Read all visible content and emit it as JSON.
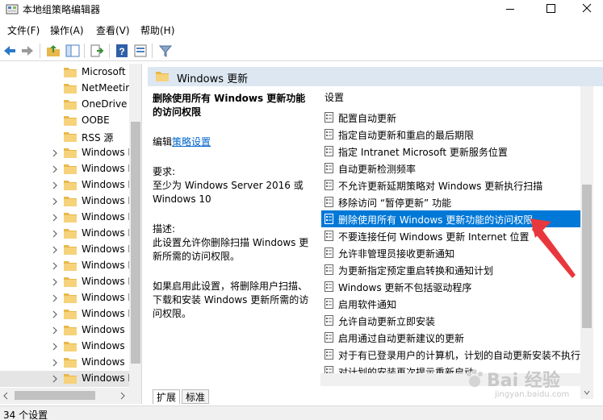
{
  "window": {
    "title": "本地组策略编辑器"
  },
  "menu": [
    "文件(F)",
    "操作(A)",
    "查看(V)",
    "帮助(H)"
  ],
  "tree": {
    "items": [
      {
        "label": "Microsoft",
        "expandable": false
      },
      {
        "label": "NetMeetir",
        "expandable": false
      },
      {
        "label": "OneDrive",
        "expandable": false
      },
      {
        "label": "OOBE",
        "expandable": false
      },
      {
        "label": "RSS 源",
        "expandable": false
      },
      {
        "label": "Windows I",
        "expandable": true
      },
      {
        "label": "Windows I",
        "expandable": true
      },
      {
        "label": "Windows I",
        "expandable": true
      },
      {
        "label": "Windows I",
        "expandable": true
      },
      {
        "label": "Windows I",
        "expandable": true
      },
      {
        "label": "Windows I",
        "expandable": true
      },
      {
        "label": "Windows I",
        "expandable": true
      },
      {
        "label": "Windows I",
        "expandable": true
      },
      {
        "label": "Windows I",
        "expandable": true
      },
      {
        "label": "Windows I",
        "expandable": true
      },
      {
        "label": "Windows I",
        "expandable": true
      },
      {
        "label": "Windows !",
        "expandable": true
      },
      {
        "label": "Windows !",
        "expandable": true
      },
      {
        "label": "Windows !",
        "expandable": true
      },
      {
        "label": "Windows I",
        "expandable": true,
        "selected": true
      }
    ]
  },
  "right": {
    "header_title": "Windows 更新",
    "desc": {
      "title": "删除使用所有 Windows 更新功能的访问权限",
      "edit_prefix": "编辑",
      "edit_link": "策略设置",
      "requirements_label": "要求:",
      "requirements_text": "至少为 Windows Server 2016 或 Windows 10",
      "description_label": "描述:",
      "description_text": "此设置允许你删除扫描 Windows 更新所需的访问权限。",
      "extra_text": "如果启用此设置，将删除用户扫描、下载和安装 Windows 更新所需的访问权限。"
    },
    "list_header": "设置",
    "settings": [
      "配置自动更新",
      "指定自动更新和重启的最后期限",
      "指定 Intranet Microsoft 更新服务位置",
      "自动更新检测频率",
      "不允许更新延期策略对 Windows 更新执行扫描",
      "移除访问 “暂停更新” 功能",
      "删除使用所有 Windows 更新功能的访问权限",
      "不要连接任何 Windows 更新 Internet 位置",
      "允许非管理员接收更新通知",
      "为更新指定预定重启转换和通知计划",
      "Windows 更新不包括驱动程序",
      "启用软件通知",
      "允许自动更新立即安装",
      "启用通过自动更新建议的更新",
      "对于有已登录用户的计算机，计划的自动更新安装不执行重",
      "对计划的安装再次提示重新启动"
    ],
    "selected_index": 6,
    "tabs": [
      "扩展",
      "标准"
    ]
  },
  "status": {
    "text": "34 个设置"
  },
  "watermark": {
    "main": "Bai 经验",
    "sub": "jingyan.baidu.com"
  },
  "colors": {
    "accent": "#0078d7",
    "header_bg": "#dde7f1",
    "arrow": "#e8383d",
    "link": "#0066cc"
  }
}
